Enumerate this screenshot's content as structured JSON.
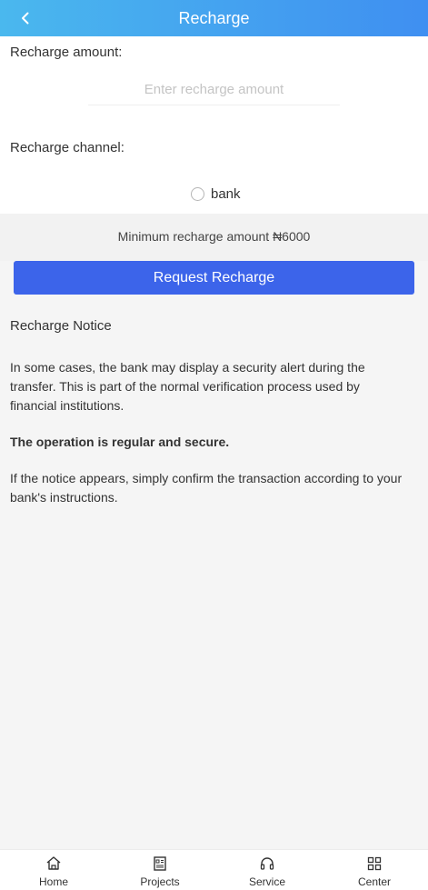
{
  "header": {
    "title": "Recharge",
    "back_icon": "chevron-left-icon"
  },
  "amount": {
    "label": "Recharge amount:",
    "placeholder": "Enter recharge amount",
    "value": ""
  },
  "channel": {
    "label": "Recharge channel:",
    "options": [
      {
        "label": "bank",
        "selected": false
      }
    ]
  },
  "minimum_note": "Minimum recharge amount ₦6000",
  "request_button": "Request Recharge",
  "notice": {
    "title": "Recharge Notice",
    "paragraph1": "In some cases, the bank may display a security alert during the transfer. This is part of the normal verification process used by financial institutions.",
    "paragraph2": "The operation is regular and secure.",
    "paragraph3": "If the notice appears, simply confirm the transaction according to your bank's instructions."
  },
  "tabbar": {
    "items": [
      {
        "label": "Home",
        "icon": "home-icon"
      },
      {
        "label": "Projects",
        "icon": "projects-icon"
      },
      {
        "label": "Service",
        "icon": "headset-icon"
      },
      {
        "label": "Center",
        "icon": "grid-icon"
      }
    ]
  },
  "colors": {
    "header_gradient_start": "#4ab8ee",
    "header_gradient_end": "#3f8ff1",
    "button": "#3c64ea"
  }
}
